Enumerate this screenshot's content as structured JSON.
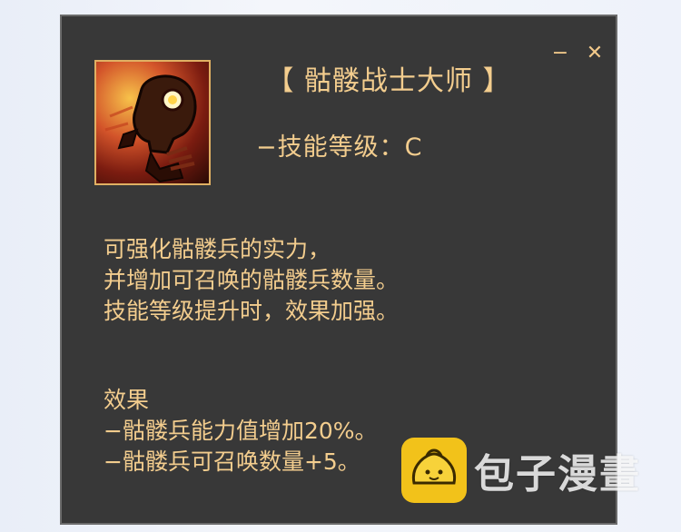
{
  "window": {
    "minimize_label": "−",
    "close_label": "✕"
  },
  "skill": {
    "icon": "skeleton-skull-icon",
    "title": "【 骷髅战士大师 】",
    "level_line": "−技能等级：C",
    "description": [
      "可强化骷髅兵的实力，",
      "并增加可召唤的骷髅兵数量。",
      "技能等级提升时，效果加强。"
    ],
    "effects_heading": "效果",
    "effects": [
      "−骷髅兵能力值增加20%。",
      "−骷髅兵可召唤数量+5。"
    ]
  },
  "watermark": {
    "icon": "bun-logo-icon",
    "text": "包子漫畫"
  },
  "colors": {
    "panel_bg": "#383838",
    "text_gold": "#f3cd8e",
    "icon_border": "#e0b063",
    "watermark_yellow": "#f2c21a"
  }
}
